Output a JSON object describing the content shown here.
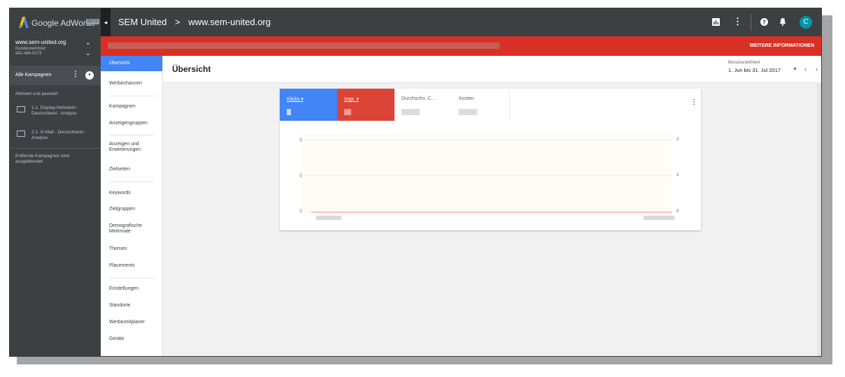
{
  "topbar": {
    "brand": "Google AdWords",
    "beta": "BETA",
    "crumb_account": "SEM United",
    "crumb_sep": ">",
    "crumb_site": "www.sem-united.org",
    "avatar_letter": "C"
  },
  "sidebar": {
    "account_name": "www.sem-united.org",
    "account_label": "Kundennummer:",
    "account_number": "442-494-0173",
    "all_campaigns": "Alle Kampagnen",
    "section": "Aktiviert und pausiert",
    "campaigns": [
      {
        "label": "1.1. Display-Netzwerk - Deutschland - Analyse"
      },
      {
        "label": "2.1. G-Mail - Deutschland - Analyse"
      }
    ],
    "removed": "Entfernte Kampagnen sind ausgeblendet"
  },
  "banner": {
    "link": "WEITERE INFORMATIONEN"
  },
  "nav": {
    "items": [
      "Übersicht",
      "Werbechancen",
      "Kampagnen",
      "Anzeigengruppen",
      "Anzeigen und Erweiterungen",
      "Zielseiten",
      "Keywords",
      "Zielgruppen",
      "Demografische Merkmale",
      "Themen",
      "Placements",
      "Einstellungen",
      "Standorte",
      "Werbezeitplaner",
      "Geräte"
    ]
  },
  "header": {
    "title": "Übersicht",
    "date_label": "Benutzerdefiniert",
    "date_range": "1. Jun bis 31. Jul 2017"
  },
  "card": {
    "metrics": [
      {
        "label": "Klicks ▾",
        "color": "#4285f4"
      },
      {
        "label": "Impr. ▾",
        "color": "#db4437"
      },
      {
        "label": "Durchschn. C..."
      },
      {
        "label": "Kosten"
      }
    ],
    "y_ticks": [
      "2",
      "1",
      "0"
    ]
  },
  "chart_data": {
    "type": "line",
    "ylim": [
      0,
      2
    ],
    "series": [
      {
        "color": "#4285f4",
        "values": [
          0
        ]
      },
      {
        "color": "#db4437",
        "values": [
          0
        ]
      }
    ]
  },
  "icons": [
    "adwords-logo-icon",
    "reports-icon",
    "more-vert-icon",
    "help-icon",
    "notifications-icon"
  ]
}
